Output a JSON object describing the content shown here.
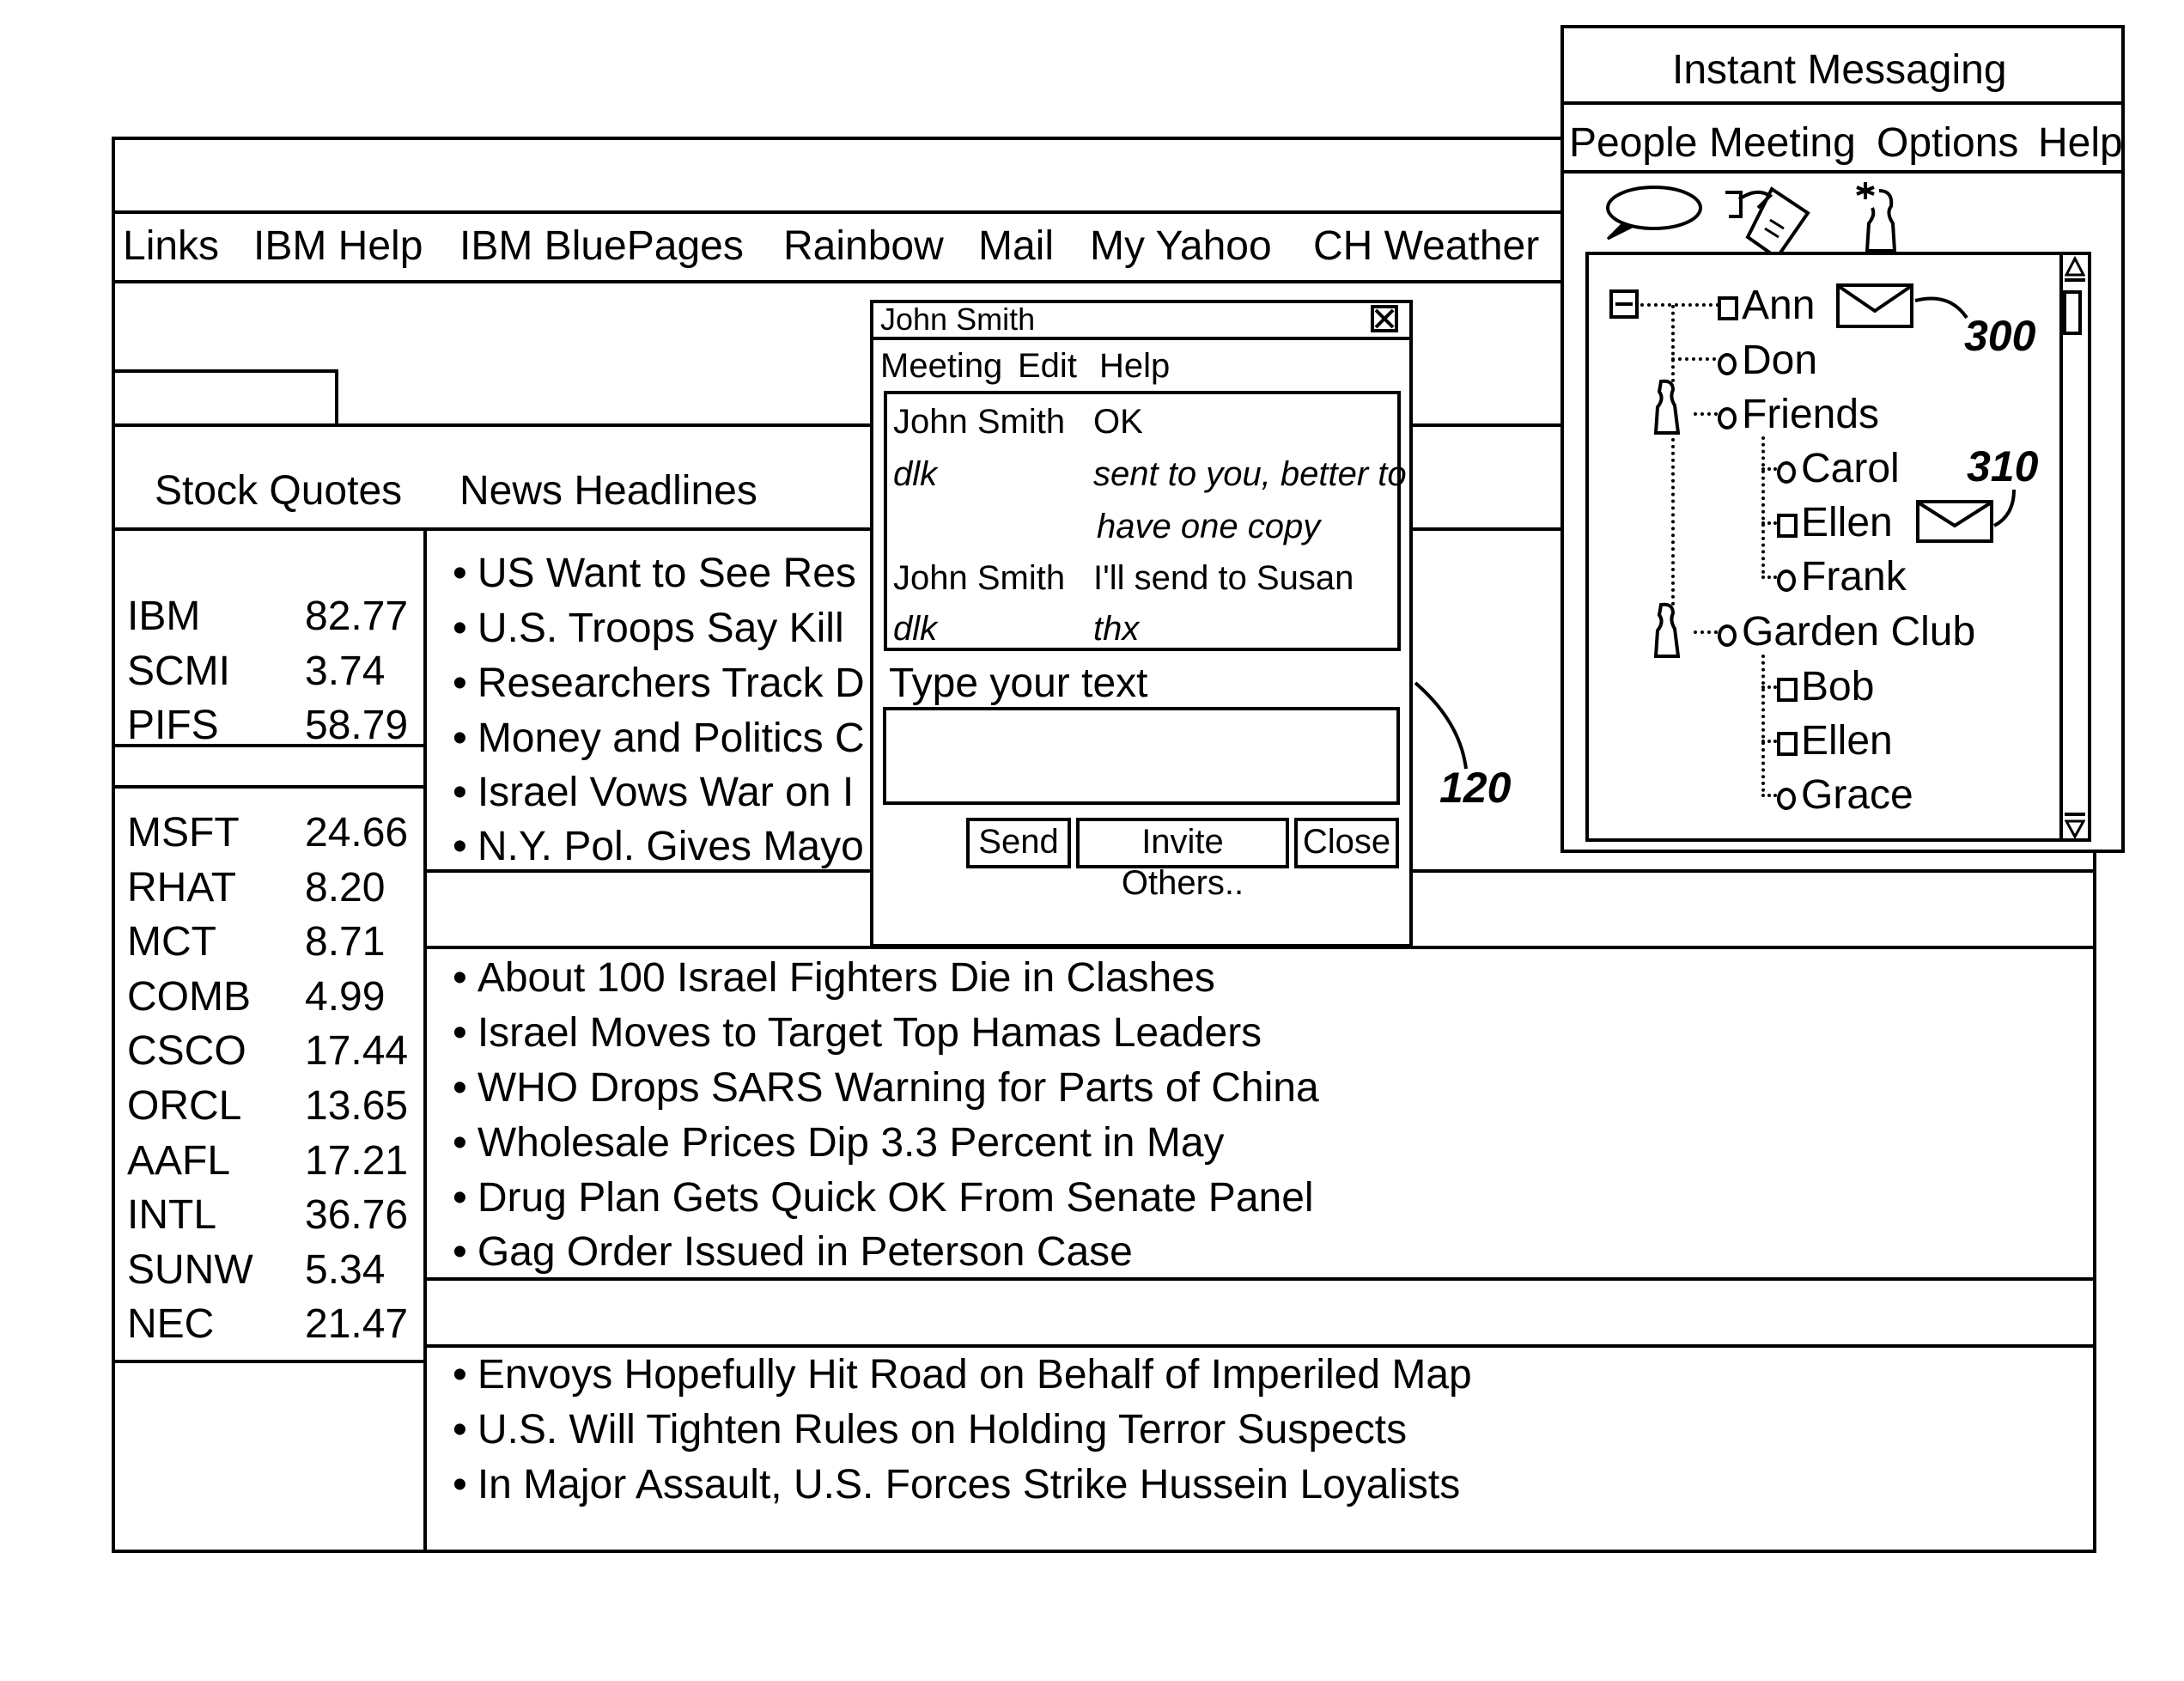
{
  "browser": {
    "links_bar": [
      "Links",
      "IBM Help",
      "IBM BluePages",
      "Rainbow",
      "Mail",
      "My Yahoo",
      "CH Weather"
    ],
    "section_headers": {
      "stocks": "Stock Quotes",
      "news": "News Headlines"
    },
    "stocks_group1": [
      {
        "symbol": "IBM",
        "price": "82.77"
      },
      {
        "symbol": "SCMI",
        "price": "3.74"
      },
      {
        "symbol": "PIFS",
        "price": "58.79"
      }
    ],
    "stocks_group2": [
      {
        "symbol": "MSFT",
        "price": "24.66"
      },
      {
        "symbol": "RHAT",
        "price": "8.20"
      },
      {
        "symbol": "MCT",
        "price": "8.71"
      },
      {
        "symbol": "COMB",
        "price": "4.99"
      },
      {
        "symbol": "CSCO",
        "price": "17.44"
      },
      {
        "symbol": "ORCL",
        "price": "13.65"
      },
      {
        "symbol": "AAFL",
        "price": "17.21"
      },
      {
        "symbol": "INTL",
        "price": "36.76"
      },
      {
        "symbol": "SUNW",
        "price": "5.34"
      },
      {
        "symbol": "NEC",
        "price": "21.47"
      }
    ],
    "news_group1": [
      "US Want to See Res",
      "U.S. Troops Say Kill",
      "Researchers Track D",
      "Money and Politics C",
      "Israel Vows War on I",
      "N.Y. Pol. Gives Mayo"
    ],
    "news_group2": [
      "About 100 Israel Fighters Die in Clashes",
      "Israel Moves to Target Top Hamas Leaders",
      "WHO Drops SARS Warning for Parts of China",
      "Wholesale Prices Dip 3.3 Percent in May",
      "Drug Plan Gets Quick OK From Senate Panel",
      "Gag Order Issued in Peterson Case"
    ],
    "news_group3": [
      "Envoys Hopefully Hit Road on Behalf of Imperiled Map",
      "U.S. Will Tighten Rules on Holding Terror Suspects",
      "In Major Assault, U.S. Forces Strike Hussein Loyalists"
    ]
  },
  "chat": {
    "title": "John Smith",
    "menu": [
      "Meeting",
      "Edit",
      "Help"
    ],
    "messages": [
      {
        "sender": "John Smith",
        "text": "OK",
        "italic": false
      },
      {
        "sender": "dlk",
        "text": "sent to you, better to",
        "italic": true
      },
      {
        "sender": "",
        "text": "have one copy",
        "italic": true
      },
      {
        "sender": "John Smith",
        "text": "I'll send to Susan",
        "italic": false
      },
      {
        "sender": "dlk",
        "text": "thx",
        "italic": true
      }
    ],
    "input_label": "Type your text",
    "input_value": "",
    "buttons": {
      "send": "Send",
      "invite": "Invite Others..",
      "close": "Close"
    }
  },
  "im": {
    "title": "Instant Messaging",
    "menu": [
      "People",
      "Meeting",
      "Options",
      "Help"
    ],
    "toolbar_icons": [
      "chat-bubble-icon",
      "meeting-hand-icon",
      "add-person-icon"
    ],
    "tree": {
      "ann": "Ann",
      "don": "Don",
      "friends": "Friends",
      "carol": "Carol",
      "ellen1": "Ellen",
      "frank": "Frank",
      "garden_club": "Garden Club",
      "bob": "Bob",
      "ellen2": "Ellen",
      "grace": "Grace"
    }
  },
  "annotations": {
    "chat_window": "120",
    "ann_message": "300",
    "ellen_message": "310"
  }
}
